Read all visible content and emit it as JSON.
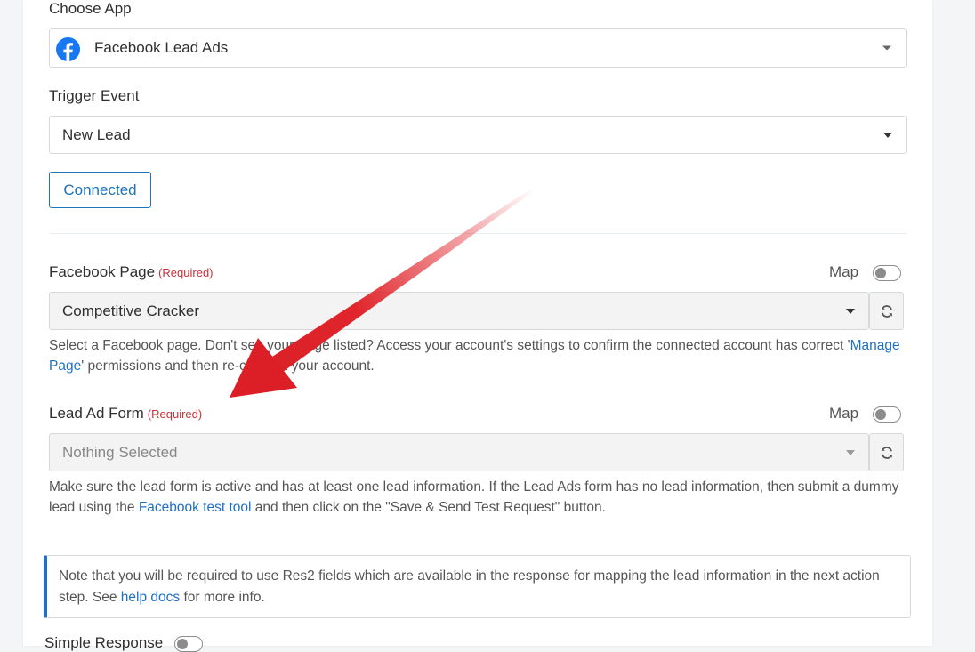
{
  "choose_app": {
    "label": "Choose App",
    "value": "Facebook Lead Ads",
    "icon": "facebook-icon"
  },
  "trigger_event": {
    "label": "Trigger Event",
    "value": "New Lead"
  },
  "connected_button": {
    "label": "Connected"
  },
  "facebook_page": {
    "label": "Facebook Page",
    "required": "(Required)",
    "map_label": "Map",
    "value": "Competitive Cracker",
    "help_part1": "Select a Facebook page. Don't see your Page listed? Access your account's settings to confirm the connected account has correct '",
    "help_link": "Manage Page",
    "help_part2": "' permissions and then re-connect your account."
  },
  "lead_ad_form": {
    "label": "Lead Ad Form",
    "required": "(Required)",
    "map_label": "Map",
    "placeholder": "Nothing Selected",
    "help_part1": "Make sure the lead form is active and has at least one lead information. If the Lead Ads form has no lead information, then submit a dummy lead using the ",
    "help_link": "Facebook test tool",
    "help_part2": " and then click on the \"Save & Send Test Request\" button."
  },
  "note": {
    "text_part1": "Note that you will be required to use Res2 fields which are available in the response for mapping the lead information in the next action step. See ",
    "link": "help docs",
    "text_part2": " for more info."
  },
  "simple_response": {
    "label": "Simple Response"
  },
  "colors": {
    "accent": "#1f73b7",
    "required": "#c8323b",
    "link": "#1f6fc5",
    "arrow": "#e0262c",
    "facebook": "#1877f2"
  }
}
